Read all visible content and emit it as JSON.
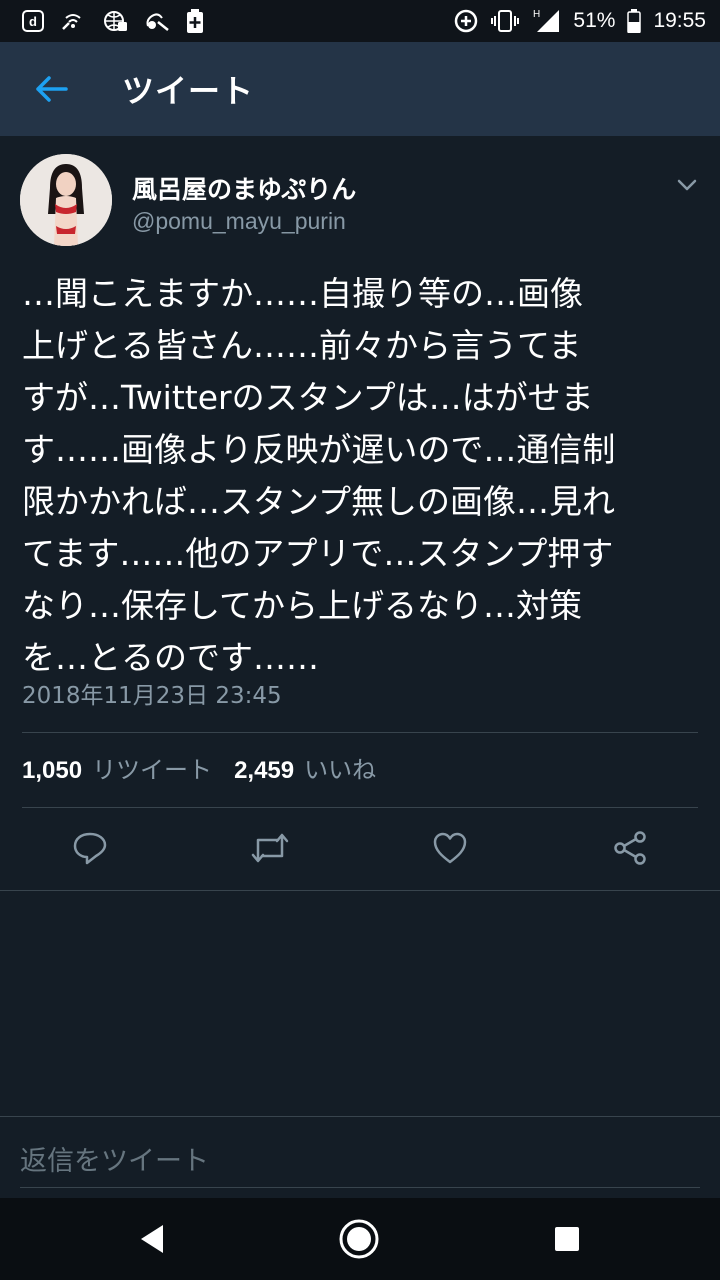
{
  "status_bar": {
    "left_icons": [
      "d-app-icon",
      "wifi-calling-icon",
      "globe-lock-icon",
      "vpn-key-icon",
      "battery-plus-icon"
    ],
    "battery_percent": "51%",
    "time": "19:55",
    "network_type": "H"
  },
  "header": {
    "title": "ツイート"
  },
  "tweet": {
    "author_name": "風呂屋のまゆぷりん",
    "author_handle": "@pomu_mayu_purin",
    "text": "…聞こえますか……自撮り等の…画像\n上げとる皆さん……前々から言うてま\nすが…Twitterのスタンプは…はがせま\nす……画像より反映が遅いので…通信制\n限かかれば…スタンプ無しの画像…見れ\nてます……他のアプリで…スタンプ押す\nなり…保存してから上げるなり…対策\nを…とるのです……",
    "timestamp": "2018年11月23日 23:45",
    "retweets_count": "1,050",
    "retweets_label": "リツイート",
    "likes_count": "2,459",
    "likes_label": "いいね"
  },
  "reply": {
    "placeholder": "返信をツイート"
  },
  "colors": {
    "background": "#141d26",
    "header": "#243447",
    "accent": "#1da1f2",
    "secondary_text": "#8899a6",
    "divider": "#38444d"
  }
}
